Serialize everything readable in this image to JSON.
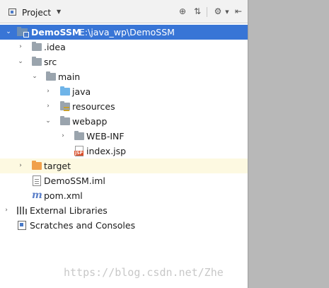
{
  "toolbar": {
    "title": "Project",
    "icons": [
      "project-icon",
      "dropdown-chevron-icon",
      "locate-target-icon",
      "collapse-all-icon",
      "settings-gear-icon",
      "hide-panel-icon"
    ]
  },
  "tree": {
    "root": {
      "name": "DemoSSM",
      "path": "E:\\java_wp\\DemoSSM"
    },
    "idea": ".idea",
    "src": "src",
    "main": "main",
    "java": "java",
    "resources": "resources",
    "webapp": "webapp",
    "webinf": "WEB-INF",
    "indexjsp": "index.jsp",
    "target": "target",
    "iml": "DemoSSM.iml",
    "pom": "pom.xml",
    "external": "External Libraries",
    "scratches": "Scratches and Consoles"
  },
  "watermark": "https://blog.csdn.net/Zhe",
  "colors": {
    "selection": "#3875d6",
    "highlight_row": "#fdf9e1",
    "right_area": "#b8b8b8"
  }
}
